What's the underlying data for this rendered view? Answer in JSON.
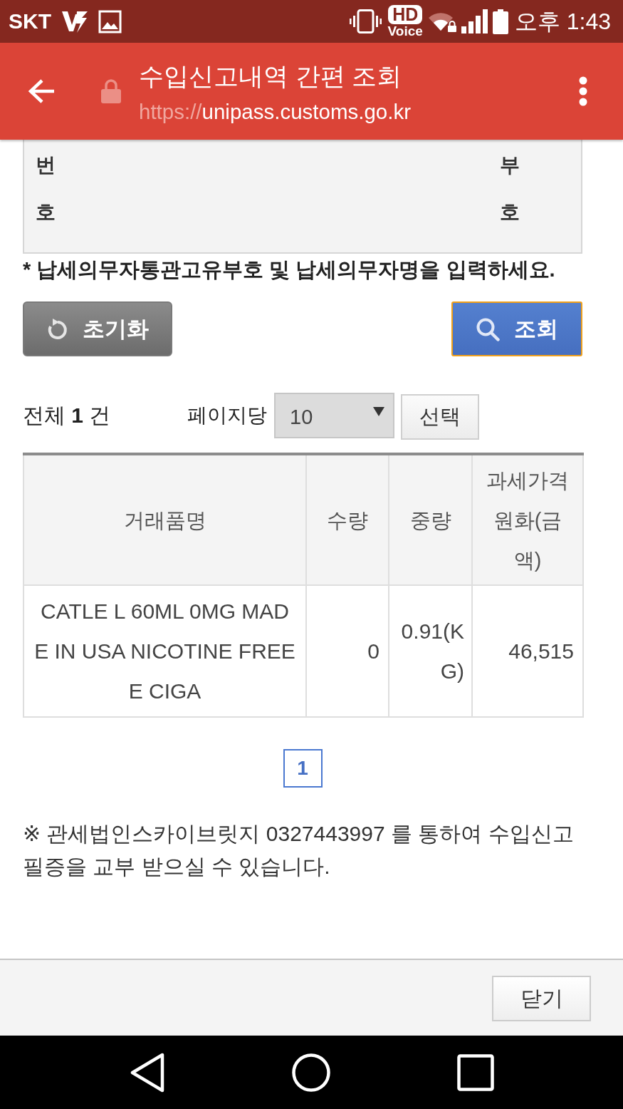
{
  "status_bar": {
    "carrier": "SKT",
    "call_badge": {
      "top": "HD",
      "bottom": "Voice"
    },
    "time": "오후 1:43"
  },
  "toolbar": {
    "title": "수입신고내역 간편 조회",
    "url": {
      "scheme": "https://",
      "host": "unipass.customs.go.kr"
    }
  },
  "form": {
    "labels": [
      "번호",
      "부호"
    ],
    "note": "* 납세의무자통관고유부호 및 납세의무자명을 입력하세요.",
    "buttons": [
      {
        "kind": "reset",
        "label": "초기화",
        "focused": false
      },
      {
        "kind": "search",
        "label": "조회",
        "focused": true
      }
    ]
  },
  "results": {
    "total": "전체 **1** 건",
    "per_page_label": "페이지당",
    "per_page": {
      "value": "10"
    },
    "apply_button": "선택"
  },
  "table": {
    "columns": [
      "거래품명",
      "수량",
      "중량",
      "과세가격원화(금액)"
    ],
    "rows": [
      [
        "CATLE L 60ML 0MG MADE IN USA NICOTINE FREE E CIGA",
        "0",
        "0.91(KG)",
        "46,515"
      ]
    ]
  },
  "pagination": [
    {
      "label": "1",
      "selected": true
    }
  ],
  "notice": "※ 관세법인스카이브릿지 0327443997 를 통하여 수입신고 필증을 교부 받으실 수 있습니다.",
  "footer": {
    "close_button": "닫기"
  }
}
